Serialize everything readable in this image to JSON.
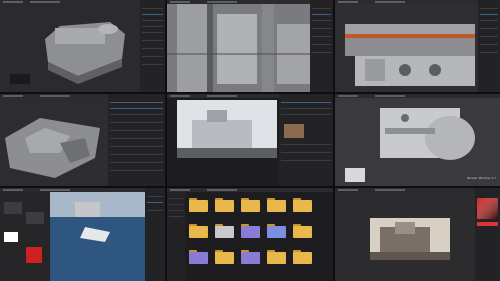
{
  "panels": [
    {
      "name": "panel-1-building-block-model"
    },
    {
      "name": "panel-2-closeup-walls"
    },
    {
      "name": "panel-3-pipes-detail"
    },
    {
      "name": "panel-4-terrain"
    },
    {
      "name": "panel-5-reference-image"
    },
    {
      "name": "panel-6-round-building-render"
    },
    {
      "name": "panel-7-node-editor-ocean"
    },
    {
      "name": "panel-8-file-browser"
    },
    {
      "name": "panel-9-image-viewer"
    }
  ],
  "panel6": {
    "status_text": "Render Window 2.7"
  },
  "file_browser": {
    "folders": [
      {
        "label": "",
        "color": "#e8b84a"
      },
      {
        "label": "",
        "color": "#e8b84a"
      },
      {
        "label": "",
        "color": "#e8b84a"
      },
      {
        "label": "",
        "color": "#e8b84a"
      },
      {
        "label": "",
        "color": "#e8b84a"
      },
      {
        "label": "",
        "color": "#e8b84a"
      },
      {
        "label": "",
        "color": "#c8c8cc"
      },
      {
        "label": "",
        "color": "#8a7bd6"
      },
      {
        "label": "",
        "color": "#7d8fe0"
      },
      {
        "label": "",
        "color": "#e8b84a"
      },
      {
        "label": "",
        "color": "#8a7bd6"
      },
      {
        "label": "",
        "color": "#e8b84a"
      },
      {
        "label": "",
        "color": "#8a7bd6"
      },
      {
        "label": "",
        "color": "#e8b84a"
      },
      {
        "label": "",
        "color": "#e8b84a"
      }
    ]
  },
  "colors": {
    "accent": "#3f5f8f",
    "folder": "#e8b84a",
    "viewport": "#303033",
    "panel": "#1d1d1f"
  }
}
